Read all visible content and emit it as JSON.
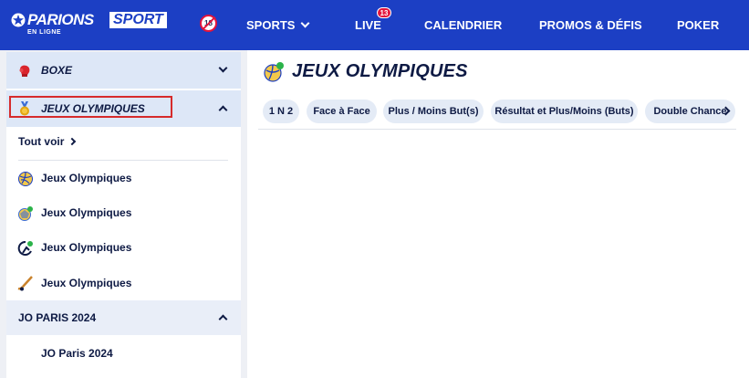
{
  "header": {
    "logo": {
      "word1": "PARIONS",
      "word2": "SPORT",
      "tagline": "EN LIGNE"
    },
    "age_limit": "18",
    "nav": [
      {
        "label": "SPORTS"
      },
      {
        "label": "LIVE",
        "badge": "13"
      },
      {
        "label": "CALENDRIER"
      },
      {
        "label": "PROMOS & DÉFIS"
      },
      {
        "label": "POKER"
      }
    ]
  },
  "sidebar": {
    "boxe": {
      "label": "BOXE",
      "icon": "boxing-glove-icon"
    },
    "jo": {
      "label": "JEUX OLYMPIQUES",
      "icon": "medal-icon"
    },
    "tout_voir": "Tout voir",
    "items": [
      {
        "label": "Jeux Olympiques",
        "icon": "volleyball-icon"
      },
      {
        "label": "Jeux Olympiques",
        "icon": "handball-icon"
      },
      {
        "label": "Jeux Olympiques",
        "icon": "water-polo-icon"
      },
      {
        "label": "Jeux Olympiques",
        "icon": "hockey-stick-icon"
      }
    ],
    "subcategory": {
      "label": "JO PARIS 2024"
    },
    "subitem": {
      "label": "JO Paris 2024"
    }
  },
  "main": {
    "title": "JEUX OLYMPIQUES",
    "tabs": [
      {
        "label": "1 N 2"
      },
      {
        "label": "Face à Face"
      },
      {
        "label": "Plus / Moins But(s)"
      },
      {
        "label": "Résultat et Plus/Moins (Buts)"
      },
      {
        "label": "Double Chance"
      }
    ]
  },
  "colors": {
    "brand": "#1c3fc4",
    "badge": "#e4143c",
    "text": "#0e1a44",
    "tab_bg": "#e4ebf6"
  }
}
